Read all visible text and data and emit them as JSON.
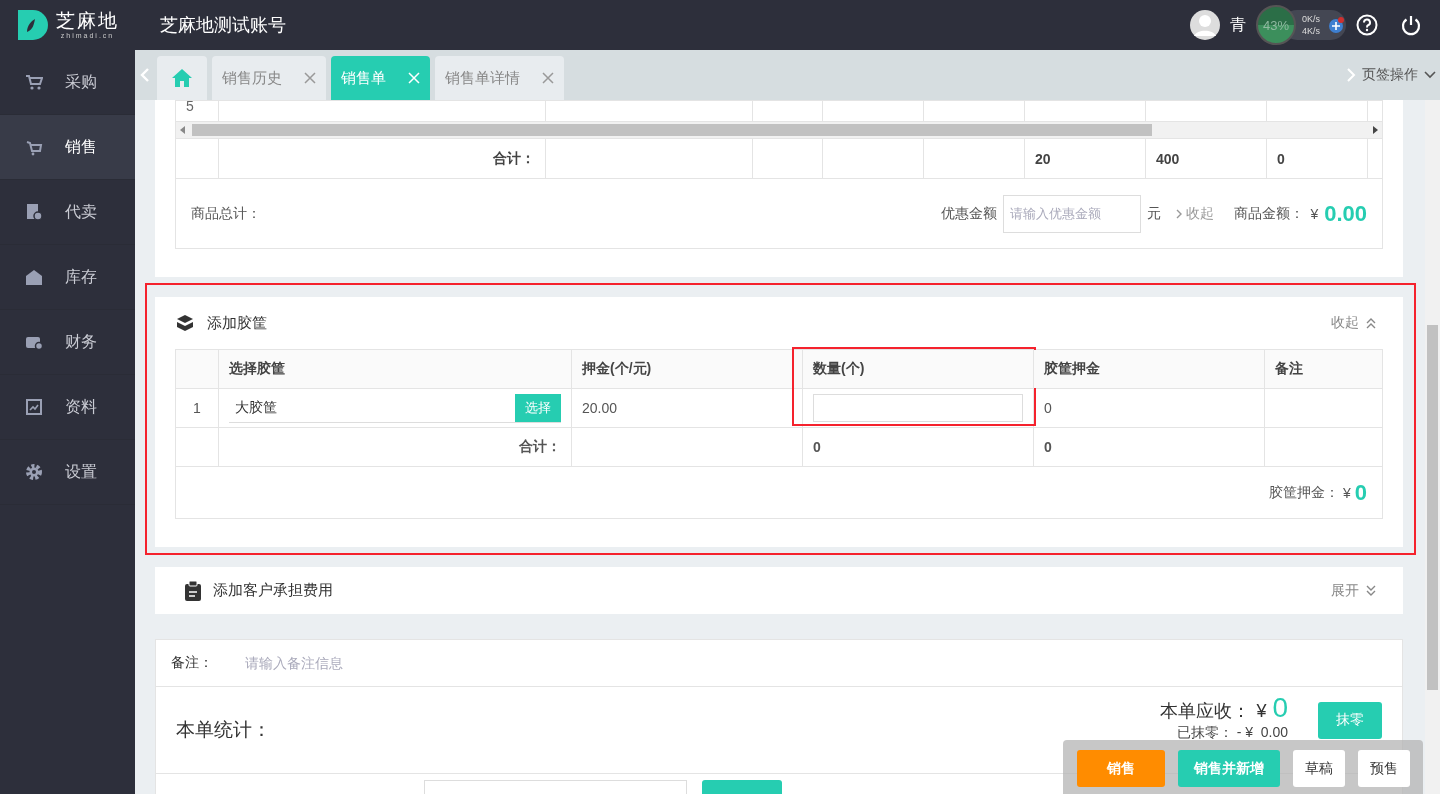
{
  "header": {
    "logo_text": "芝麻地",
    "logo_subtext": "zhimadi.cn",
    "account": "芝麻地测试账号",
    "user": "青"
  },
  "net_widget": {
    "percent": "43%",
    "upload": "0K/s",
    "download": "4K/s"
  },
  "sidebar": {
    "items": [
      {
        "label": "采购",
        "kind": "cart",
        "selected": false
      },
      {
        "label": "销售",
        "kind": "sale",
        "selected": true
      },
      {
        "label": "代卖",
        "kind": "doc",
        "selected": false
      },
      {
        "label": "库存",
        "kind": "house",
        "selected": false
      },
      {
        "label": "财务",
        "kind": "wallet",
        "selected": false
      },
      {
        "label": "资料",
        "kind": "chart",
        "selected": false
      },
      {
        "label": "设置",
        "kind": "gear",
        "selected": false
      }
    ]
  },
  "tabs": [
    {
      "kind": "home",
      "selected": false
    },
    {
      "kind": "page",
      "label": "销售历史",
      "selected": false
    },
    {
      "kind": "page",
      "label": "销售单",
      "selected": true
    },
    {
      "kind": "page",
      "label": "销售单详情",
      "selected": false
    }
  ],
  "tab_actions": "页签操作",
  "goods_table": {
    "row_index": "5",
    "total_label": "合计：",
    "totals": {
      "column_6": "20",
      "column_7": "400",
      "column_8": "0"
    }
  },
  "goods_summary": {
    "label": "商品总计：",
    "discount_label": "优惠金额",
    "discount_placeholder": "请输入优惠金额",
    "unit": "元",
    "toggle": "收起",
    "amount_label": "商品金额：",
    "currency": "¥",
    "amount": "0.00"
  },
  "crate_section": {
    "title": "添加胶筐",
    "toggle": "收起",
    "expanded": true,
    "highlighted": true,
    "columns": [
      {
        "label": "选择胶筐",
        "highlighted": false
      },
      {
        "label": "押金(个/元)",
        "highlighted": false
      },
      {
        "label": "数量(个)",
        "highlighted": true
      },
      {
        "label": "胶筐押金",
        "highlighted": false
      },
      {
        "label": "备注",
        "highlighted": false
      }
    ],
    "rows": [
      {
        "index": "1",
        "crate": "大胶筐",
        "select_button": "选择",
        "deposit": "20.00",
        "crate_deposit": "0"
      }
    ],
    "total_label": "合计：",
    "total_quantity": "0",
    "total_deposit": "0",
    "deposit_label": "胶筐押金：",
    "currency": "¥",
    "deposit_amount": "0"
  },
  "fee_section": {
    "title": "添加客户承担费用",
    "toggle": "展开",
    "expanded": false
  },
  "remarks": {
    "label": "备注：",
    "placeholder": "请输入备注信息"
  },
  "stats": {
    "title": "本单统计：",
    "receivable_label": "本单应收：",
    "currency": "¥",
    "receivable": "0",
    "round_off_button": "抹零",
    "rounded_label": "已抹零：",
    "rounded_value": "- ¥  0.00"
  },
  "actions": [
    {
      "label": "销售",
      "kind": "primary"
    },
    {
      "label": "销售并新增",
      "kind": "secondary"
    },
    {
      "label": "草稿",
      "kind": "plain"
    },
    {
      "label": "预售",
      "kind": "plain"
    }
  ]
}
